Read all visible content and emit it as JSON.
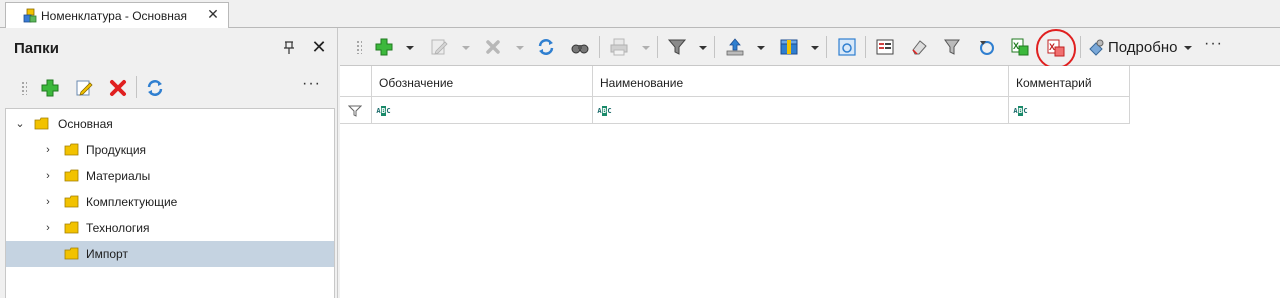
{
  "tab": {
    "title": "Номенклатура - Основная",
    "icon": "catalog-icon"
  },
  "left_panel": {
    "title": "Папки",
    "toolbar": [
      "add-icon",
      "edit-icon",
      "delete-icon",
      "refresh-icon"
    ],
    "more": "···",
    "tree": [
      {
        "label": "Основная",
        "expanded": true,
        "level": 0
      },
      {
        "label": "Продукция",
        "expanded": false,
        "level": 1
      },
      {
        "label": "Материалы",
        "expanded": false,
        "level": 1
      },
      {
        "label": "Комплектующие",
        "expanded": false,
        "level": 1
      },
      {
        "label": "Технология",
        "expanded": false,
        "level": 1
      },
      {
        "label": "Импорт",
        "expanded": false,
        "level": 1,
        "selected": true
      }
    ]
  },
  "main_toolbar": {
    "detail_label": "Подробно",
    "more": "···",
    "highlighted": "export-pdf-icon"
  },
  "grid": {
    "columns": [
      "Обозначение",
      "Наименование",
      "Комментарий"
    ],
    "filter_placeholder": "ABC"
  },
  "colors": {
    "selected_row": "#c5d3e1",
    "highlight_ring": "#e02020",
    "folder": "#f2c200"
  }
}
